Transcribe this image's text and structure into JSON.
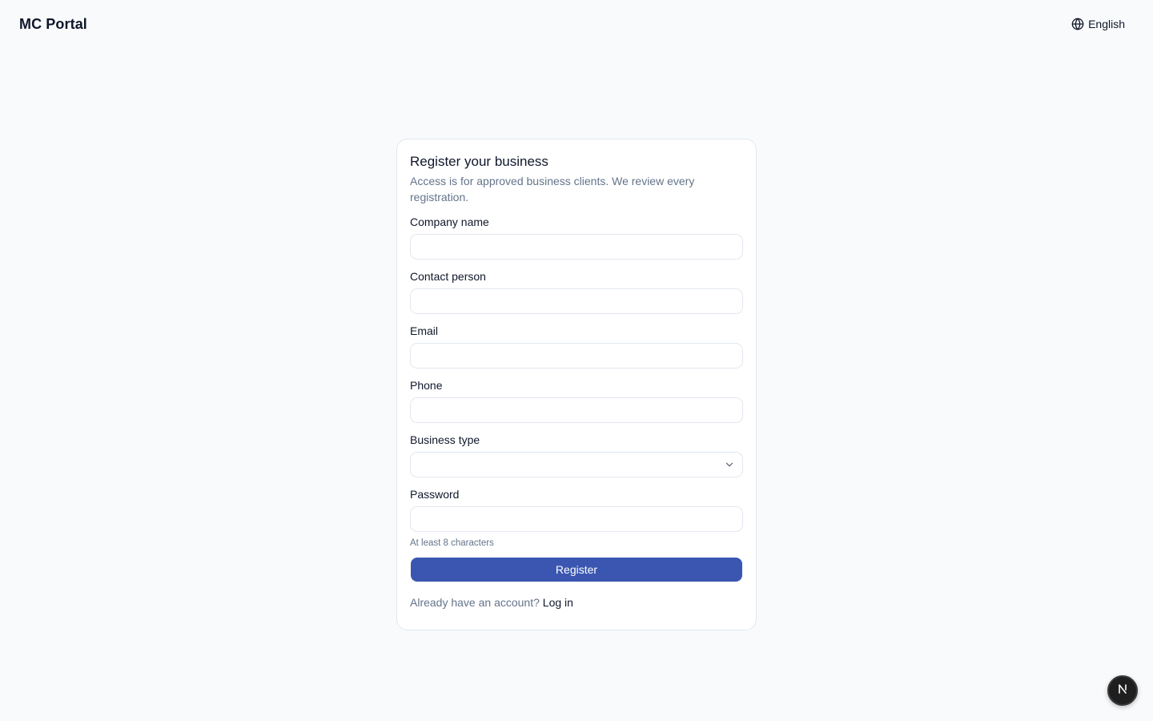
{
  "header": {
    "brand": "MC Portal",
    "language": "English"
  },
  "form": {
    "title": "Register your business",
    "description": "Access is for approved business clients. We review every registration.",
    "fields": {
      "company_name": {
        "label": "Company name",
        "value": ""
      },
      "contact_person": {
        "label": "Contact person",
        "value": ""
      },
      "email": {
        "label": "Email",
        "value": ""
      },
      "phone": {
        "label": "Phone",
        "value": ""
      },
      "business_type": {
        "label": "Business type",
        "value": ""
      },
      "password": {
        "label": "Password",
        "value": "",
        "hint": "At least 8 characters"
      }
    },
    "submit_label": "Register",
    "footer_text": "Already have an account?",
    "login_link": "Log in"
  },
  "colors": {
    "background": "#f8fafc",
    "primary_button": "#3a56b0",
    "muted_text": "#64748b",
    "border": "#e2e8f0"
  },
  "icons": {
    "language": "globe-icon",
    "select": "chevron-down-icon",
    "dev_badge": "next-logo-icon"
  }
}
